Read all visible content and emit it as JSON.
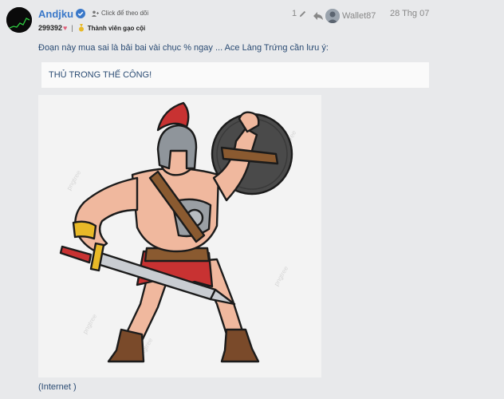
{
  "post": {
    "author": "Andjku",
    "follow_label": "Click để theo dõi",
    "score": "299392",
    "rank_label": "Thành viên gạo cội",
    "edit_count": "1",
    "reply_to_user": "Wallet87",
    "date": "28 Thg 07",
    "body_text": "Đoạn này mua sai là bải bai vài chục % ngay ... Ace Làng Trứng cần lưu ý:",
    "quote_text": "THỦ TRONG THẾ CÔNG!",
    "caption": "(Internet )"
  },
  "image": {
    "watermark": "pngtree",
    "subject": "cartoon-gladiator-with-sword-and-shield"
  },
  "colors": {
    "author_link": "#3a78c9",
    "verified": "#3a78c9",
    "text_blue": "#2a4b73",
    "background": "#e8e9eb",
    "heart": "#e0607a",
    "medal": "#e8b928"
  }
}
